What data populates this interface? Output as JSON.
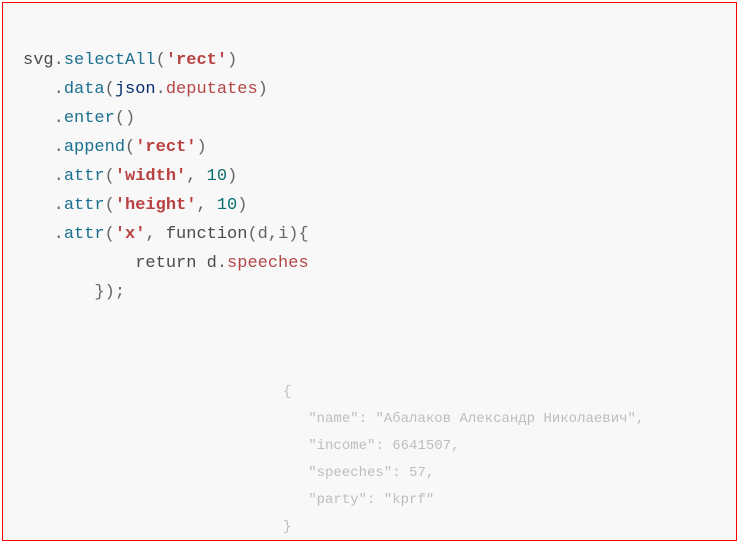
{
  "code": {
    "l1": {
      "obj": "svg",
      "dot": ".",
      "sel": "selectAll",
      "p1": "(",
      "str": "'rect'",
      "p2": ")"
    },
    "l2": {
      "indent": "   ",
      "dot": ".",
      "m": "data",
      "p1": "(",
      "arg": "json",
      "d2": ".",
      "prop": "deputates",
      "p2": ")"
    },
    "l3": {
      "indent": "   ",
      "dot": ".",
      "m": "enter",
      "p1": "(",
      "p2": ")"
    },
    "l4": {
      "indent": "   ",
      "dot": ".",
      "m": "append",
      "p1": "(",
      "str": "'rect'",
      "p2": ")"
    },
    "l5": {
      "indent": "   ",
      "dot": ".",
      "m": "attr",
      "p1": "(",
      "str": "'width'",
      "c": ", ",
      "num": "10",
      "p2": ")"
    },
    "l6": {
      "indent": "   ",
      "dot": ".",
      "m": "attr",
      "p1": "(",
      "str": "'height'",
      "c": ", ",
      "num": "10",
      "p2": ")"
    },
    "l7": {
      "indent": "   ",
      "dot": ".",
      "m": "attr",
      "p1": "(",
      "str": "'x'",
      "c": ", ",
      "fn": "function",
      "args": "(d,i){"
    },
    "l8": {
      "indent": "           ",
      "ret": "return ",
      "d": "d",
      "dot": ".",
      "prop": "speeches"
    },
    "l9": {
      "indent": "       ",
      "close": "});"
    }
  },
  "json_sample": {
    "brace_open": "{",
    "k_name": "\"name\"",
    "v_name": "\"Абалаков Александр Николаевич\"",
    "k_income": "\"income\"",
    "v_income": "6641507",
    "k_speeches": "\"speeches\"",
    "v_speeches": "57",
    "k_party": "\"party\"",
    "v_party": "\"kprf\"",
    "brace_close": "}",
    "colon": ": ",
    "comma": ",",
    "indent": "   "
  }
}
